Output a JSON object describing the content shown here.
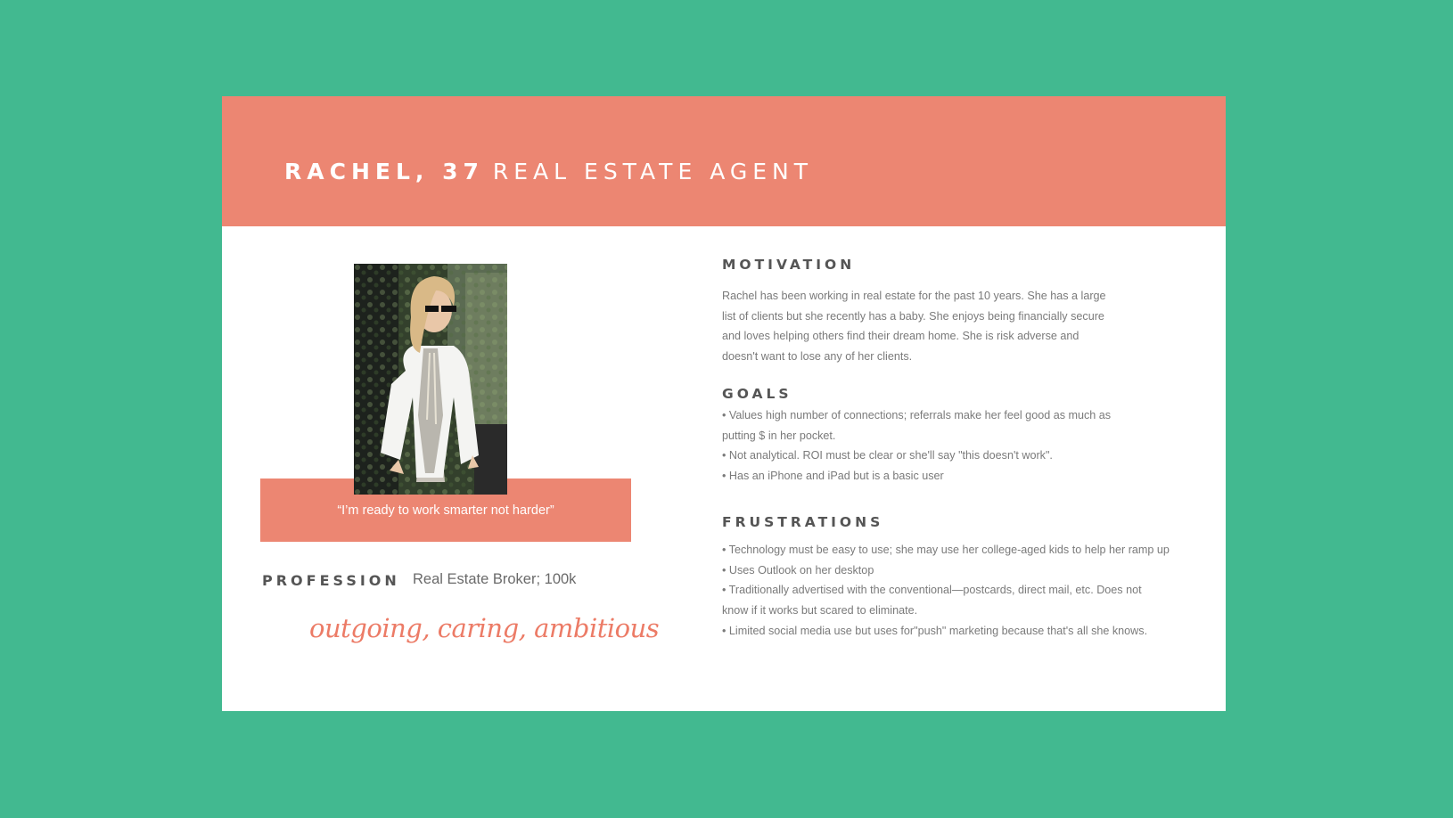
{
  "header": {
    "name_age": "RACHEL, 37",
    "role": "REAL ESTATE AGENT"
  },
  "quote": "“I’m ready to work smarter not harder”",
  "profession": {
    "label": "PROFESSION",
    "value": "Real Estate Broker; 100k"
  },
  "traits": "outgoing, caring, ambitious",
  "motivation": {
    "heading": "MOTIVATION",
    "lines": [
      "Rachel has been working in real estate for the past 10 years. She has a large",
      "list of clients but she recently has a baby. She enjoys being financially secure",
      "and loves helping others find their dream home. She is risk adverse and",
      "doesn't want to lose any of her clients."
    ]
  },
  "goals": {
    "heading": "GOALS",
    "lines": [
      "• Values high number of connections; referrals make her feel good as much as",
      "putting $ in her pocket.",
      "• Not analytical. ROI must be clear or she'll say \"this doesn't work\".",
      "• Has an iPhone and iPad but is a basic user"
    ]
  },
  "frustrations": {
    "heading": "FRUSTRATIONS",
    "lines": [
      "• Technology must be easy to use; she may use her college-aged kids to help her ramp up",
      "• Uses Outlook on her desktop",
      "• Traditionally advertised with the conventional—postcards, direct mail, etc. Does not",
      "know if it works but scared to eliminate.",
      "• Limited social media use but uses for\"push\" marketing because that's all she knows."
    ]
  },
  "colors": {
    "background": "#42b990",
    "accent": "#ec8672",
    "card": "#ffffff"
  }
}
